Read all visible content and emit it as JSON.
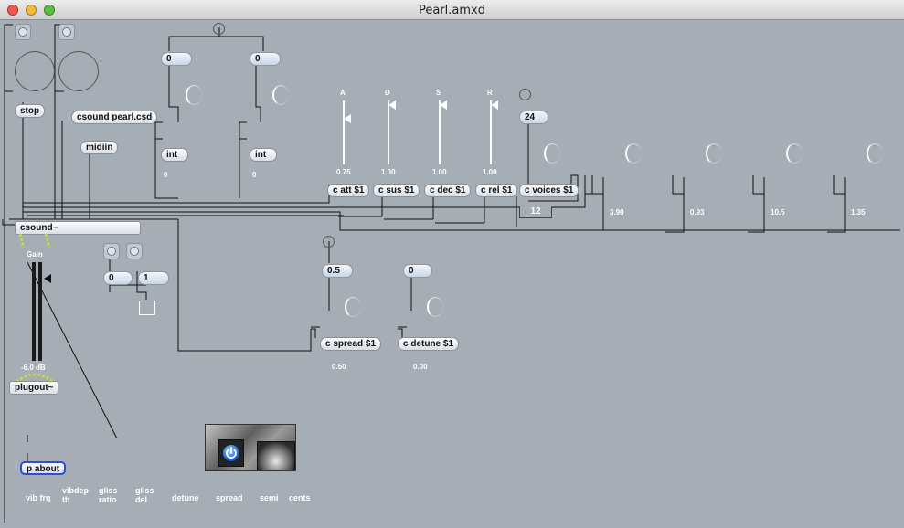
{
  "window": {
    "title": "Pearl.amxd"
  },
  "colors": {
    "close": "#ee5a52",
    "minimize": "#f4bb3a",
    "zoom": "#5cc045",
    "canvas": "#a6adb4"
  },
  "objects": {
    "stop": "stop",
    "csound_file": "csound pearl.csd",
    "midiin": "midiin",
    "int_a": "int",
    "int_b": "int",
    "csound": "csound~",
    "plugout": "plugout~",
    "about": "p about",
    "c_att": "c att $1",
    "c_sus": "c sus $1",
    "c_dec": "c dec $1",
    "c_rel": "c rel $1",
    "c_voices": "c voices $1",
    "c_spread": "c spread $1",
    "c_detune": "c detune $1"
  },
  "numbers": {
    "top_left": "0",
    "top_right": "0",
    "int_a_out": "0",
    "int_b_out": "0",
    "voices": "24",
    "voices_box": "12",
    "spread_in": "0.5",
    "detune_in": "0",
    "toggle_zero": "0",
    "toggle_one": "1",
    "spread_out": "0.50",
    "detune_out": "0.00"
  },
  "adsr": {
    "labels": [
      "A",
      "D",
      "S",
      "R"
    ],
    "values": [
      "0.75",
      "1.00",
      "1.00",
      "1.00"
    ],
    "levels": [
      0.75,
      1.0,
      1.0,
      1.0
    ]
  },
  "dial_readouts": [
    "3.90",
    "0.93",
    "10.5",
    "1.35"
  ],
  "gain": {
    "label": "Gain",
    "db": "-6.0 dB"
  },
  "bottom_labels": [
    "vib frq",
    "vibdep th",
    "gliss ratio",
    "gliss del",
    "detune",
    "spread",
    "semi",
    "cents"
  ],
  "icons": [
    "power-icon",
    "knob-image-icon"
  ]
}
